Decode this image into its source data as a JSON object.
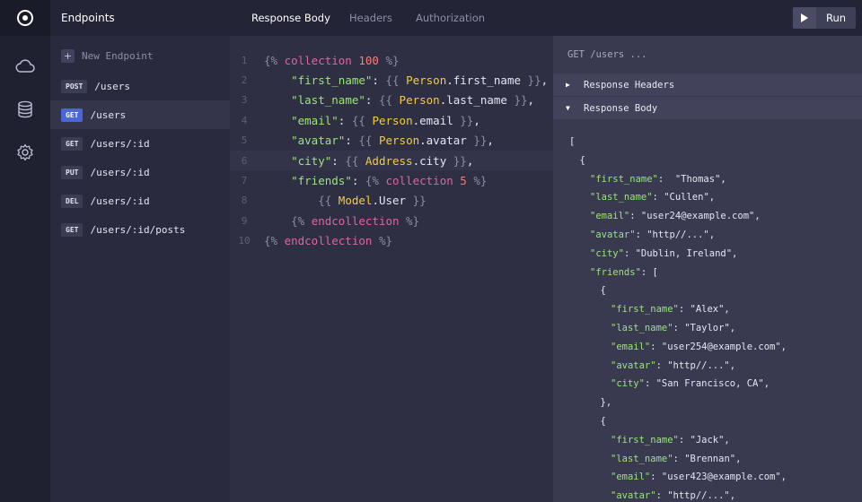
{
  "sidebar": {
    "title": "Endpoints",
    "new_label": "New Endpoint",
    "new_plus": "+",
    "endpoints": [
      {
        "method": "POST",
        "path": "/users"
      },
      {
        "method": "GET",
        "path": "/users"
      },
      {
        "method": "GET",
        "path": "/users/:id"
      },
      {
        "method": "PUT",
        "path": "/users/:id"
      },
      {
        "method": "DEL",
        "path": "/users/:id"
      },
      {
        "method": "GET",
        "path": "/users/:id/posts"
      }
    ]
  },
  "rail": {
    "icons": [
      "logo-icon",
      "cloud-icon",
      "database-icon",
      "gear-icon"
    ]
  },
  "tabs": [
    "Response Body",
    "Headers",
    "Authorization"
  ],
  "run_label": "Run",
  "editor": {
    "line_numbers": [
      "1",
      "2",
      "3",
      "4",
      "5",
      "6",
      "7",
      "8",
      "9",
      "10"
    ],
    "lines": [
      [
        [
          "{% ",
          "delim"
        ],
        [
          "collection ",
          "kw"
        ],
        [
          "100",
          "num"
        ],
        [
          " %}",
          "delim"
        ]
      ],
      [
        [
          "    ",
          "plain"
        ],
        [
          "\"first_name\"",
          "str"
        ],
        [
          ": ",
          "plain"
        ],
        [
          "{{ ",
          "delim"
        ],
        [
          "Person",
          "obj"
        ],
        [
          ".first_name",
          "plain"
        ],
        [
          " }}",
          "delim"
        ],
        [
          ",",
          "plain"
        ]
      ],
      [
        [
          "    ",
          "plain"
        ],
        [
          "\"last_name\"",
          "str"
        ],
        [
          ": ",
          "plain"
        ],
        [
          "{{ ",
          "delim"
        ],
        [
          "Person",
          "obj"
        ],
        [
          ".last_name",
          "plain"
        ],
        [
          " }}",
          "delim"
        ],
        [
          ",",
          "plain"
        ]
      ],
      [
        [
          "    ",
          "plain"
        ],
        [
          "\"email\"",
          "str"
        ],
        [
          ": ",
          "plain"
        ],
        [
          "{{ ",
          "delim"
        ],
        [
          "Person",
          "obj"
        ],
        [
          ".email",
          "plain"
        ],
        [
          " }}",
          "delim"
        ],
        [
          ",",
          "plain"
        ]
      ],
      [
        [
          "    ",
          "plain"
        ],
        [
          "\"avatar\"",
          "str"
        ],
        [
          ": ",
          "plain"
        ],
        [
          "{{ ",
          "delim"
        ],
        [
          "Person",
          "obj"
        ],
        [
          ".avatar",
          "plain"
        ],
        [
          " }}",
          "delim"
        ],
        [
          ",",
          "plain"
        ]
      ],
      [
        [
          "    ",
          "plain"
        ],
        [
          "\"city\"",
          "str"
        ],
        [
          ": ",
          "plain"
        ],
        [
          "{{ ",
          "delim"
        ],
        [
          "Address",
          "obj"
        ],
        [
          ".city",
          "plain"
        ],
        [
          " }}",
          "delim"
        ],
        [
          ",",
          "plain"
        ]
      ],
      [
        [
          "    ",
          "plain"
        ],
        [
          "\"friends\"",
          "str"
        ],
        [
          ": ",
          "plain"
        ],
        [
          "{% ",
          "delim"
        ],
        [
          "collection ",
          "kw"
        ],
        [
          "5",
          "num"
        ],
        [
          " %}",
          "delim"
        ]
      ],
      [
        [
          "        ",
          "plain"
        ],
        [
          "{{ ",
          "delim"
        ],
        [
          "Model",
          "obj"
        ],
        [
          ".User",
          "plain"
        ],
        [
          " }}",
          "delim"
        ]
      ],
      [
        [
          "    ",
          "plain"
        ],
        [
          "{% ",
          "delim"
        ],
        [
          "endcollection",
          "kw"
        ],
        [
          " %}",
          "delim"
        ]
      ],
      [
        [
          "{% ",
          "delim"
        ],
        [
          "endcollection",
          "kw"
        ],
        [
          " %}",
          "delim"
        ]
      ],
      []
    ]
  },
  "response": {
    "request_line": "GET /users ...",
    "sections": [
      {
        "caret": "▶",
        "label": "Response Headers"
      },
      {
        "caret": "▼",
        "label": "Response Body"
      }
    ],
    "json_lines": [
      {
        "indent": 0,
        "key": "",
        "text": "["
      },
      {
        "indent": 1,
        "key": "",
        "text": "{"
      },
      {
        "indent": 2,
        "key": "\"first_name\"",
        "text": ":  \"Thomas\","
      },
      {
        "indent": 2,
        "key": "\"last_name\"",
        "text": ": \"Cullen\","
      },
      {
        "indent": 2,
        "key": "\"email\"",
        "text": ": \"user24@example.com\","
      },
      {
        "indent": 2,
        "key": "\"avatar\"",
        "text": ": \"http//...\","
      },
      {
        "indent": 2,
        "key": "\"city\"",
        "text": ": \"Dublin, Ireland\","
      },
      {
        "indent": 2,
        "key": "\"friends\"",
        "text": ": ["
      },
      {
        "indent": 3,
        "key": "",
        "text": "{"
      },
      {
        "indent": 4,
        "key": "\"first_name\"",
        "text": ": \"Alex\","
      },
      {
        "indent": 4,
        "key": "\"last_name\"",
        "text": ": \"Taylor\","
      },
      {
        "indent": 4,
        "key": "\"email\"",
        "text": ": \"user254@example.com\","
      },
      {
        "indent": 4,
        "key": "\"avatar\"",
        "text": ": \"http//...\","
      },
      {
        "indent": 4,
        "key": "\"city\"",
        "text": ": \"San Francisco, CA\","
      },
      {
        "indent": 3,
        "key": "",
        "text": "},"
      },
      {
        "indent": 3,
        "key": "",
        "text": "{"
      },
      {
        "indent": 4,
        "key": "\"first_name\"",
        "text": ": \"Jack\","
      },
      {
        "indent": 4,
        "key": "\"last_name\"",
        "text": ": \"Brennan\","
      },
      {
        "indent": 4,
        "key": "\"email\"",
        "text": ": \"user423@example.com\","
      },
      {
        "indent": 4,
        "key": "\"avatar\"",
        "text": ": \"http//...\","
      }
    ]
  },
  "colors": {
    "accent": "#4a67d8",
    "keyword": "#e063a6",
    "string": "#9be67b",
    "object": "#f5cc3c",
    "number": "#ff7a7a"
  }
}
